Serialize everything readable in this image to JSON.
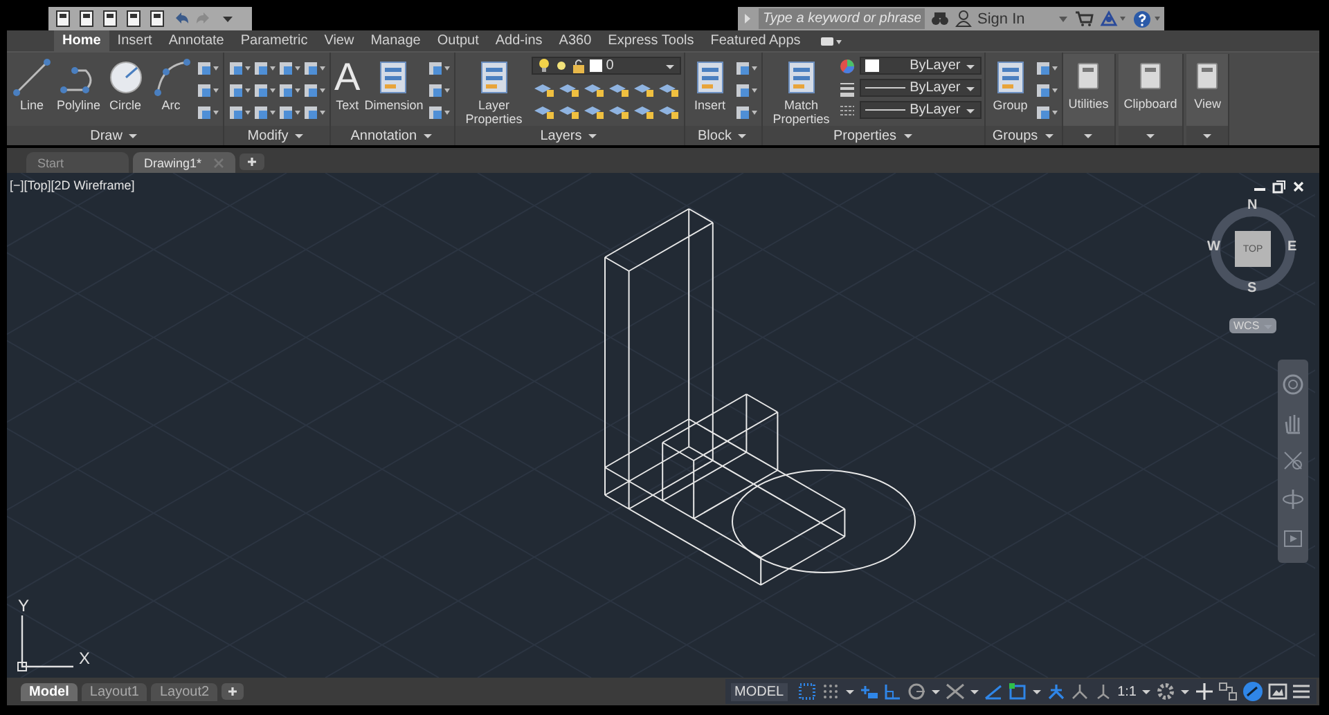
{
  "search": {
    "placeholder": "Type a keyword or phrase"
  },
  "account": {
    "sign_in": "Sign In"
  },
  "ribbon_tabs": [
    {
      "label": "Home",
      "selected": true
    },
    {
      "label": "Insert",
      "selected": false
    },
    {
      "label": "Annotate",
      "selected": false
    },
    {
      "label": "Parametric",
      "selected": false
    },
    {
      "label": "View",
      "selected": false
    },
    {
      "label": "Manage",
      "selected": false
    },
    {
      "label": "Output",
      "selected": false
    },
    {
      "label": "Add-ins",
      "selected": false
    },
    {
      "label": "A360",
      "selected": false
    },
    {
      "label": "Express Tools",
      "selected": false
    },
    {
      "label": "Featured Apps",
      "selected": false
    }
  ],
  "panels": [
    {
      "title": "Draw",
      "tools": [
        {
          "kind": "large",
          "label": "Line"
        },
        {
          "kind": "large",
          "label": "Polyline"
        },
        {
          "kind": "large",
          "label": "Circle"
        },
        {
          "kind": "large",
          "label": "Arc"
        },
        {
          "kind": "column"
        }
      ]
    },
    {
      "title": "Modify",
      "tools": [
        {
          "kind": "grid"
        }
      ]
    },
    {
      "title": "Annotation",
      "tools": [
        {
          "kind": "letter",
          "glyph": "A",
          "label": "Text"
        },
        {
          "kind": "large",
          "label": "Dimension"
        },
        {
          "kind": "column"
        }
      ]
    },
    {
      "title": "Layers",
      "tools": [
        {
          "kind": "large",
          "label": "Layer Properties"
        },
        {
          "kind": "layer",
          "value": "0"
        }
      ]
    },
    {
      "title": "Block",
      "tools": [
        {
          "kind": "large",
          "label": "Insert"
        },
        {
          "kind": "column"
        }
      ]
    },
    {
      "title": "Properties",
      "tools": [
        {
          "kind": "large",
          "label": "Match Properties"
        },
        {
          "kind": "dropdowns",
          "values": [
            "ByLayer",
            "ByLayer",
            "ByLayer"
          ]
        }
      ]
    },
    {
      "title": "Groups",
      "tools": [
        {
          "kind": "large",
          "label": "Group"
        },
        {
          "kind": "column"
        }
      ]
    },
    {
      "label": "Utilities"
    },
    {
      "label": "Clipboard"
    },
    {
      "label": "View"
    }
  ],
  "doc_tabs": [
    {
      "label": "Start",
      "selected": false
    },
    {
      "label": "Drawing1*",
      "selected": true
    }
  ],
  "viewport": {
    "label": "[−][Top][2D Wireframe]"
  },
  "viewcube": {
    "north": "N",
    "south": "S",
    "east": "E",
    "west": "W",
    "face": "TOP",
    "coordinate_system": "WCS"
  },
  "ucs": {
    "y": "Y",
    "x": "X"
  },
  "layout_tabs": [
    {
      "label": "Model",
      "selected": true
    },
    {
      "label": "Layout1",
      "selected": false
    },
    {
      "label": "Layout2",
      "selected": false
    }
  ],
  "status_bar": {
    "model": "MODEL",
    "annotation_scale": "1:1",
    "toggles": [
      {
        "on": true
      },
      {
        "on": false
      },
      {
        "on": true
      },
      {
        "on": true
      },
      {
        "on": false
      },
      {
        "on": false
      },
      {
        "on": true
      },
      {
        "on": true
      },
      {
        "on": true
      },
      {
        "on": false
      },
      {
        "on": false
      }
    ]
  }
}
